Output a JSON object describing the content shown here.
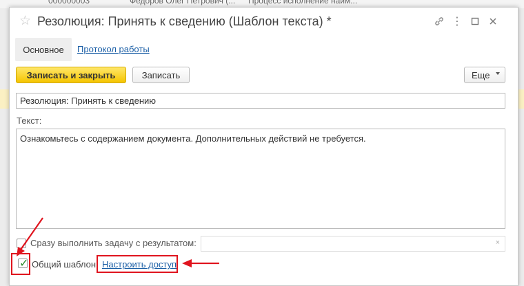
{
  "background": {
    "row_number": "000000003",
    "row_author": "Федоров Олег Петрович (...",
    "row_process": "Процесс исполнение найм..."
  },
  "dialog": {
    "title": "Резолюция: Принять к сведению (Шаблон текста) *",
    "tabs": [
      {
        "label": "Основное"
      },
      {
        "label": "Протокол работы"
      }
    ],
    "toolbar": {
      "save_close_label": "Записать и закрыть",
      "save_label": "Записать",
      "more_label": "Еще"
    },
    "name_field_value": "Резолюция: Принять к сведению",
    "text_label": "Текст:",
    "text_value": "Ознакомьтесь с содержанием документа. Дополнительных действий не требуется.",
    "execute_label": "Сразу выполнить задачу с результатом:",
    "execute_checked": false,
    "result_value": "",
    "common_template_label": "Общий шаблон",
    "common_template_checked": true,
    "access_link_label": "Настроить доступ"
  },
  "colors": {
    "accent_yellow": "#f5c500",
    "link_blue": "#1a5ea6",
    "annotation_red": "#e0141e",
    "check_green": "#2a8b2a"
  }
}
